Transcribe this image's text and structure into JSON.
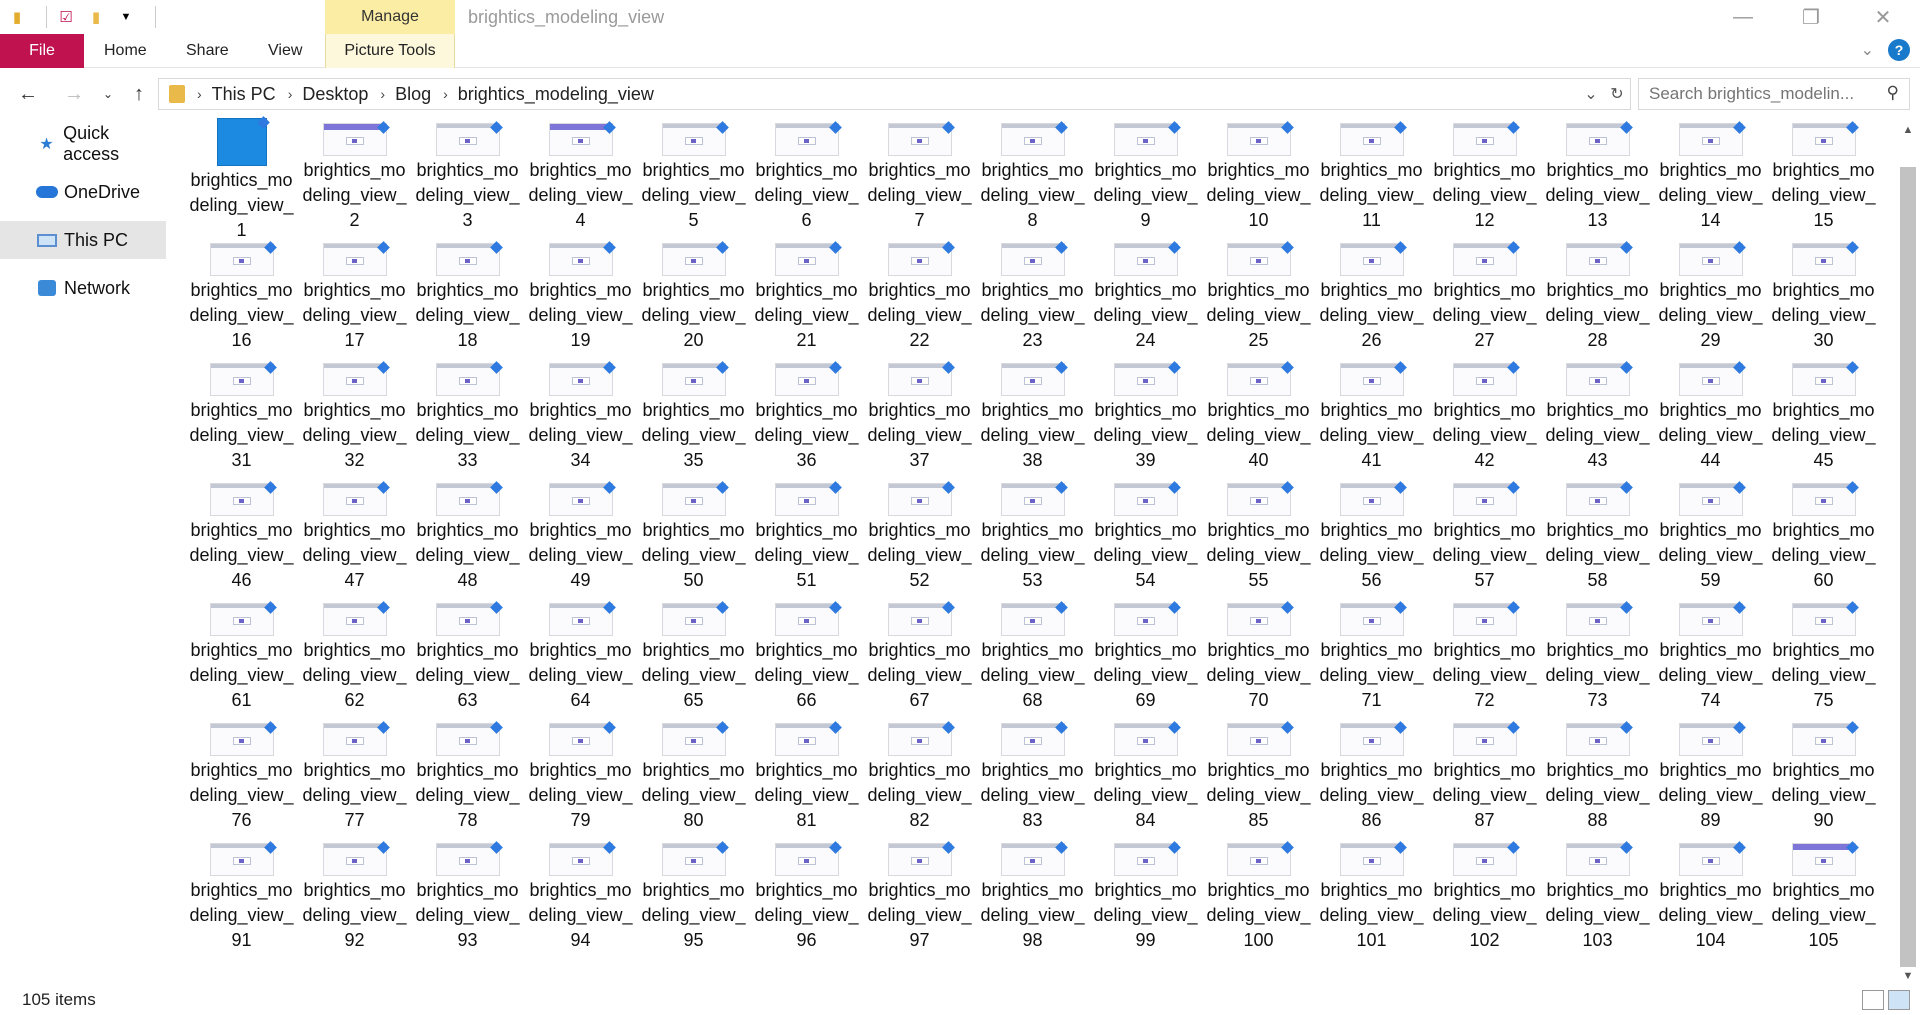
{
  "window": {
    "title": "brightics_modeling_view",
    "manage_label": "Manage",
    "minimize": "—",
    "maximize": "❐",
    "close": "✕"
  },
  "ribbon": {
    "tabs": [
      "File",
      "Home",
      "Share",
      "View",
      "Picture Tools"
    ]
  },
  "address": {
    "crumbs": [
      "This PC",
      "Desktop",
      "Blog",
      "brightics_modeling_view"
    ],
    "search_placeholder": "Search brightics_modelin..."
  },
  "nav_pane": {
    "items": [
      {
        "label": "Quick access",
        "icon": "star-icon"
      },
      {
        "label": "OneDrive",
        "icon": "cloud-icon"
      },
      {
        "label": "This PC",
        "icon": "computer-icon"
      },
      {
        "label": "Network",
        "icon": "network-icon"
      }
    ]
  },
  "files": {
    "prefix": "brightics_modeling_view_",
    "count": 105
  },
  "status": {
    "item_count": "105 items"
  }
}
